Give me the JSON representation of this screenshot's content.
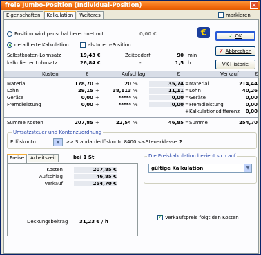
{
  "window": {
    "title": "freie Jumbo-Position  (Individual-Position)",
    "close": "×"
  },
  "tabs": [
    "Eigenschaften",
    "Kalkulation",
    "Weiteres"
  ],
  "markieren_label": "markieren",
  "options": {
    "pauschal_label": "Position wird pauschal berechnet mit",
    "pauschal_value": "0,00 €",
    "detail_label": "detaillierte Kalkulation",
    "intern_label": "als Intern-Position"
  },
  "buttons": {
    "ok": "OK",
    "abbrechen": "Abbrechen",
    "vk_historie": "VK-Historie",
    "euro_symbol": "€"
  },
  "basics": {
    "selbstkosten_label": "Selbstkosten-Lohnsatz",
    "selbstkosten_value": "19,43 €",
    "zeitbedarf_label": "Zeitbedarf",
    "zeitbedarf_value": "90",
    "zeitbedarf_unit": "min",
    "kalkulierter_label": "kalkulierter Lohnsatz",
    "kalkulierter_value": "26,84 €",
    "kalkulierter_sep": "-",
    "kalkulierter_time": "1,5",
    "kalkulierter_unit": "h"
  },
  "table": {
    "headers": {
      "kosten": "Kosten",
      "euro1": "€",
      "aufschlag": "Aufschlag",
      "euro2": "€",
      "verkauf": "Verkauf",
      "euro3": "€"
    },
    "rows": [
      {
        "label": "Material",
        "kosten": "178,70",
        "op": "+",
        "pct": "20",
        "pct_unit": "%",
        "auf": "35,74",
        "eq": "=",
        "right_label": "Material",
        "verkauf": "214,44"
      },
      {
        "label": "Lohn",
        "kosten": "29,15",
        "op": "+",
        "pct": "38,113",
        "pct_unit": "%",
        "auf": "11,11",
        "eq": "=",
        "right_label": "Lohn",
        "verkauf": "40,26"
      },
      {
        "label": "Geräte",
        "kosten": "0,00",
        "op": "+",
        "pct": "*****",
        "pct_unit": "%",
        "auf": "0,00",
        "eq": "=",
        "right_label": "Geräte",
        "verkauf": "0,00"
      },
      {
        "label": "Fremdleistung",
        "kosten": "0,00",
        "op": "+",
        "pct": "*****",
        "pct_unit": "%",
        "auf": "0,00",
        "eq": "=",
        "right_label": "Fremdleistung",
        "verkauf": "0,00"
      },
      {
        "label": "",
        "kosten": "",
        "op": "",
        "pct": "",
        "pct_unit": "",
        "auf": "",
        "eq": "+",
        "right_label": "Kalkulationsdifferenz",
        "verkauf": "0,00"
      }
    ],
    "summe": {
      "label": "Summe Kosten",
      "kosten": "207,85",
      "op": "+",
      "pct": "22,54",
      "pct_unit": "%",
      "auf": "46,85",
      "eq": "=",
      "right_label": "Summe",
      "verkauf": "254,70"
    }
  },
  "umsatz": {
    "heading": "Umsatzsteuer und Kontenzuordnung",
    "erloes_label": "Erlöskonto",
    "erloes_text": ">> Standarderlöskonto 8400 <<",
    "steuer_label": "Steuerklasse",
    "steuer_value": "2"
  },
  "lower": {
    "tabs": [
      "Preise",
      "Arbeitszeit"
    ],
    "bei_text": "bei 1 St",
    "rows": [
      {
        "label": "Kosten",
        "value": "207,85 €"
      },
      {
        "label": "Aufschlag",
        "value": "46,85 €"
      },
      {
        "label": "Verkauf",
        "value": "254,70 €"
      }
    ],
    "deckung_label": "Deckungsbeitrag",
    "deckung_value": "31,23 € / h"
  },
  "preiskalk": {
    "heading": "Die Preiskalkulation bezieht sich auf",
    "selected": "gültige Kalkulation",
    "verkaufspreis_label": "Verkaufspreis folgt den Kosten"
  }
}
